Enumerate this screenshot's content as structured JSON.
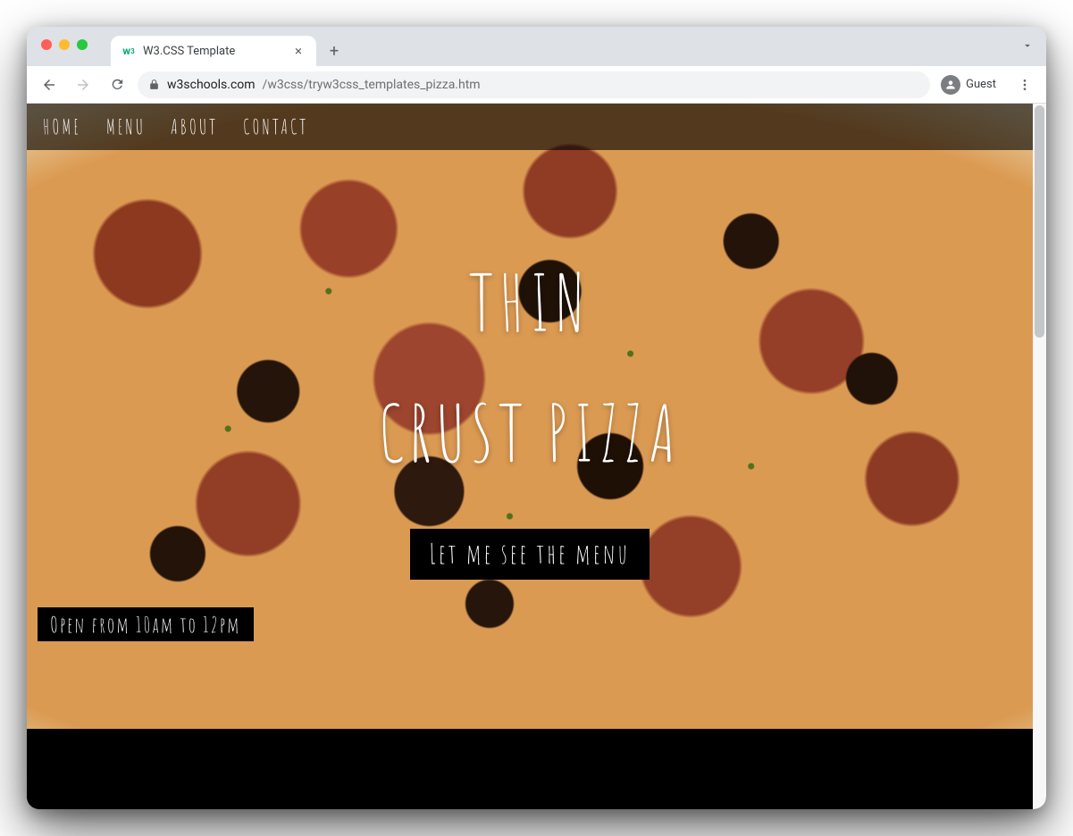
{
  "browser": {
    "tab_title": "W3.CSS Template",
    "url_host": "w3schools.com",
    "url_path": "/w3css/tryw3css_templates_pizza.htm",
    "guest_label": "Guest"
  },
  "nav": {
    "items": [
      "HOME",
      "MENU",
      "ABOUT",
      "CONTACT"
    ]
  },
  "hero": {
    "title_line1": "THIN",
    "title_line2": "CRUST PIZZA",
    "cta_label": "Let me see the menu",
    "hours_text": "Open from 10am to 12pm"
  }
}
